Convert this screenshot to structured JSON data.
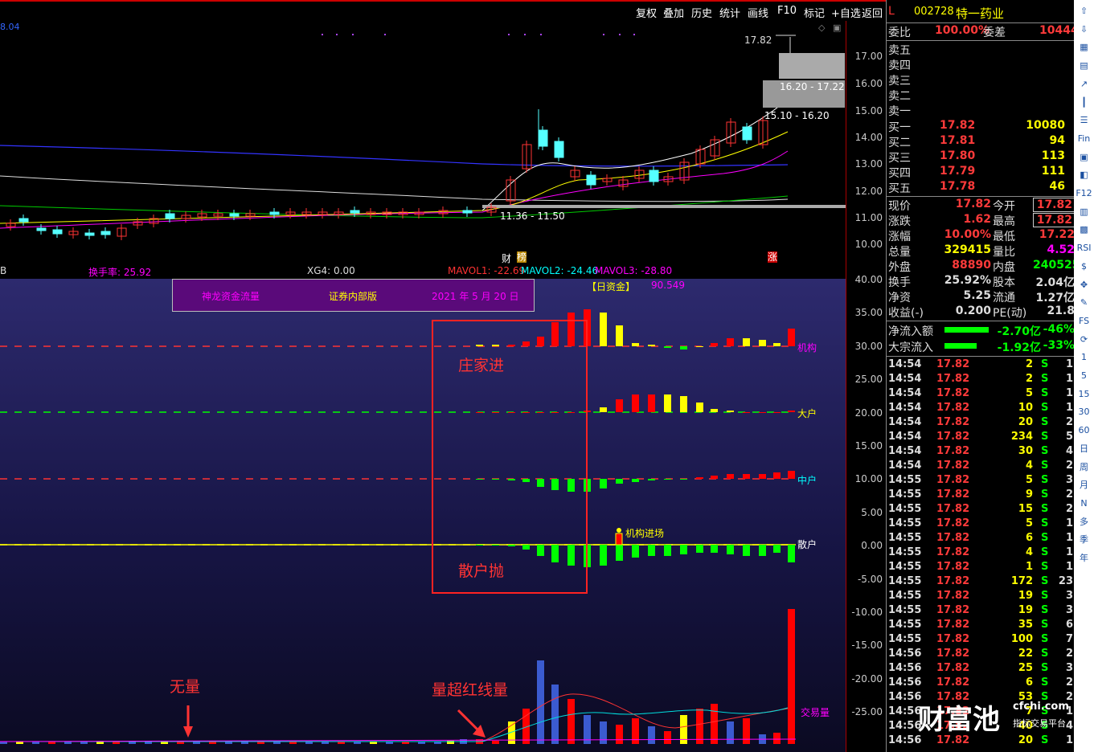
{
  "toolbar": {
    "buttons": [
      "复权",
      "叠加",
      "历史",
      "统计",
      "画线",
      "F10",
      "标记",
      "+自选",
      "返回"
    ]
  },
  "stock": {
    "flag": "L",
    "code": "002728",
    "name": "特一药业"
  },
  "kline": {
    "price_axis": [
      "17.00",
      "16.00",
      "15.00",
      "14.00",
      "13.00",
      "12.00",
      "11.00",
      "10.00"
    ],
    "top_label": "8.04",
    "max_label": "17.82",
    "zone1": "16.20 - 17.22",
    "zone2": "15.10 - 16.20",
    "zone3": "11.36 - 11.50",
    "marker_cai": "财",
    "marker_bang": "榜",
    "marker_zhang": "涨"
  },
  "indicators": {
    "left": "B",
    "turnover": "换手率: 25.92",
    "xg4": "XG4: 0.00",
    "mavol1": "MAVOL1: -22.69",
    "mavol2": "MAVOL2: -24.46",
    "mavol3": "MAVOL3: -28.80"
  },
  "flow": {
    "title": "神龙资金流量",
    "edition": "证券内部版",
    "date": "2021 年 5 月 20 日",
    "tag": "【日资金】",
    "tag_value": "90.549",
    "line_jigou": "机构",
    "line_dahu": "大户",
    "line_zhonghu": "中户",
    "line_sanhu": "散户",
    "signal": "机构进场",
    "volume_line": "交易量",
    "annot_zhuang": "庄家进",
    "annot_sanhu": "散户抛",
    "annot_wuliang": "无量",
    "annot_chao": "量超红线量",
    "axis": [
      "40.00",
      "35.00",
      "30.00",
      "25.00",
      "20.00",
      "15.00",
      "10.00",
      "5.00",
      "0.00",
      "-5.00",
      "-10.00",
      "-15.00",
      "-20.00",
      "-25.00"
    ]
  },
  "quote": {
    "weibi_label": "委比",
    "weibi": "100.00%",
    "weicha_label": "委差",
    "weicha": "10444",
    "asks": [
      {
        "label": "卖五"
      },
      {
        "label": "卖四"
      },
      {
        "label": "卖三"
      },
      {
        "label": "卖二"
      },
      {
        "label": "卖一"
      }
    ],
    "bids": [
      {
        "label": "买一",
        "price": "17.82",
        "vol": "10080"
      },
      {
        "label": "买二",
        "price": "17.81",
        "vol": "94"
      },
      {
        "label": "买三",
        "price": "17.80",
        "vol": "113"
      },
      {
        "label": "买四",
        "price": "17.79",
        "vol": "111"
      },
      {
        "label": "买五",
        "price": "17.78",
        "vol": "46"
      }
    ],
    "stats": [
      {
        "l1": "现价",
        "v1": "17.82",
        "l2": "今开",
        "v2": "17.82",
        "c1": "red",
        "c2": "red",
        "box2": true
      },
      {
        "l1": "涨跌",
        "v1": "1.62",
        "l2": "最高",
        "v2": "17.82",
        "c1": "red",
        "c2": "red",
        "box2": true
      },
      {
        "l1": "涨幅",
        "v1": "10.00%",
        "l2": "最低",
        "v2": "17.22",
        "c1": "red",
        "c2": "red",
        "box2": false
      },
      {
        "l1": "总量",
        "v1": "329415",
        "l2": "量比",
        "v2": "4.52",
        "c1": "yel",
        "c2": "mag",
        "box2": false
      },
      {
        "l1": "外盘",
        "v1": "88890",
        "l2": "内盘",
        "v2": "240525",
        "c1": "red",
        "c2": "grn",
        "box2": false
      },
      {
        "l1": "换手",
        "v1": "25.92%",
        "l2": "股本",
        "v2": "2.04亿",
        "c1": "lbl",
        "c2": "lbl",
        "box2": false
      },
      {
        "l1": "净资",
        "v1": "5.25",
        "l2": "流通",
        "v2": "1.27亿",
        "c1": "lbl",
        "c2": "lbl",
        "box2": false
      },
      {
        "l1": "收益(-)",
        "v1": "0.200",
        "l2": "PE(动)",
        "v2": "21.8",
        "c1": "lbl",
        "c2": "lbl",
        "box2": false
      }
    ],
    "netflow": [
      {
        "label": "净流入额",
        "value": "-2.70亿",
        "pct": "-46%",
        "bar": 0.92
      },
      {
        "label": "大宗流入",
        "value": "-1.92亿",
        "pct": "-33%",
        "bar": 0.66
      }
    ]
  },
  "ticks": [
    [
      "14:54",
      "17.82",
      "2",
      "S",
      "1"
    ],
    [
      "14:54",
      "17.82",
      "2",
      "S",
      "1"
    ],
    [
      "14:54",
      "17.82",
      "5",
      "S",
      "1"
    ],
    [
      "14:54",
      "17.82",
      "10",
      "S",
      "1"
    ],
    [
      "14:54",
      "17.82",
      "20",
      "S",
      "2"
    ],
    [
      "14:54",
      "17.82",
      "234",
      "S",
      "5"
    ],
    [
      "14:54",
      "17.82",
      "30",
      "S",
      "4"
    ],
    [
      "14:54",
      "17.82",
      "4",
      "S",
      "2"
    ],
    [
      "14:55",
      "17.82",
      "5",
      "S",
      "3"
    ],
    [
      "14:55",
      "17.82",
      "9",
      "S",
      "2"
    ],
    [
      "14:55",
      "17.82",
      "15",
      "S",
      "2"
    ],
    [
      "14:55",
      "17.82",
      "5",
      "S",
      "1"
    ],
    [
      "14:55",
      "17.82",
      "6",
      "S",
      "1"
    ],
    [
      "14:55",
      "17.82",
      "4",
      "S",
      "1"
    ],
    [
      "14:55",
      "17.82",
      "1",
      "S",
      "1"
    ],
    [
      "14:55",
      "17.82",
      "172",
      "S",
      "23"
    ],
    [
      "14:55",
      "17.82",
      "19",
      "S",
      "3"
    ],
    [
      "14:55",
      "17.82",
      "19",
      "S",
      "3"
    ],
    [
      "14:55",
      "17.82",
      "35",
      "S",
      "6"
    ],
    [
      "14:55",
      "17.82",
      "100",
      "S",
      "7"
    ],
    [
      "14:56",
      "17.82",
      "22",
      "S",
      "2"
    ],
    [
      "14:56",
      "17.82",
      "25",
      "S",
      "3"
    ],
    [
      "14:56",
      "17.82",
      "6",
      "S",
      "2"
    ],
    [
      "14:56",
      "17.82",
      "53",
      "S",
      "2"
    ],
    [
      "14:56",
      "17.82",
      "7",
      "S",
      "1"
    ],
    [
      "14:56",
      "17.82",
      "40",
      "S",
      "4"
    ],
    [
      "14:56",
      "17.82",
      "20",
      "S",
      "1"
    ]
  ],
  "sidebar": {
    "items": [
      {
        "icon": "up-arrow-icon",
        "text": "⇧"
      },
      {
        "icon": "down-arrow-icon",
        "text": "⇩"
      },
      {
        "icon": "grid-icon",
        "text": "▦"
      },
      {
        "icon": "table-icon",
        "text": "▤"
      },
      {
        "icon": "line-chart-icon",
        "text": "↗"
      },
      {
        "icon": "candle-icon",
        "text": "┃"
      },
      {
        "icon": "list-icon",
        "text": "☰"
      },
      {
        "icon": "fin-icon",
        "text": "Fin"
      },
      {
        "icon": "doc-icon",
        "text": "▣"
      },
      {
        "icon": "page-icon",
        "text": "◧"
      },
      {
        "icon": "f12-icon",
        "text": "F12"
      },
      {
        "icon": "bars-icon",
        "text": "▥"
      },
      {
        "icon": "grid2-icon",
        "text": "▩"
      },
      {
        "icon": "rsi-icon",
        "text": "RSI"
      },
      {
        "icon": "dollar-icon",
        "text": "$"
      },
      {
        "icon": "move-icon",
        "text": "✥"
      },
      {
        "icon": "pen-icon",
        "text": "✎"
      },
      {
        "icon": "fs-icon",
        "text": "FS"
      },
      {
        "icon": "refresh-icon",
        "text": "⟳"
      },
      {
        "icon": "p1",
        "text": "1"
      },
      {
        "icon": "p5",
        "text": "5"
      },
      {
        "icon": "p15",
        "text": "15"
      },
      {
        "icon": "p30",
        "text": "30"
      },
      {
        "icon": "p60",
        "text": "60"
      },
      {
        "icon": "day",
        "text": "日"
      },
      {
        "icon": "week",
        "text": "周"
      },
      {
        "icon": "month",
        "text": "月"
      },
      {
        "icon": "n",
        "text": "N"
      },
      {
        "icon": "multi",
        "text": "多"
      },
      {
        "icon": "season",
        "text": "季"
      },
      {
        "icon": "year",
        "text": "年"
      }
    ]
  },
  "watermark": {
    "brand": "财富池",
    "site": "cfchi.com",
    "tagline": "指标交易平台"
  }
}
